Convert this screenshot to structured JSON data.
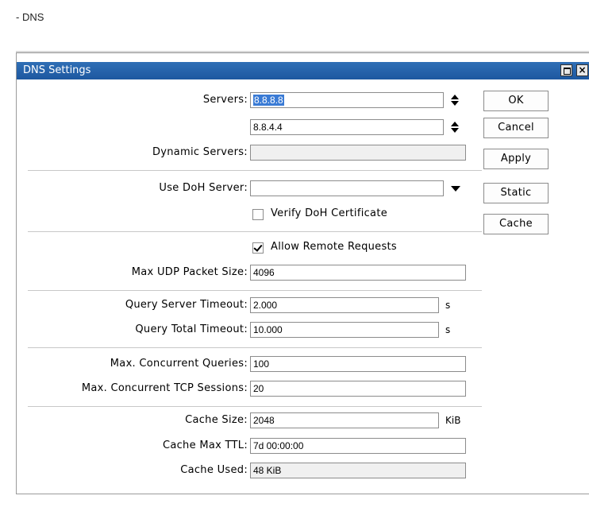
{
  "page": {
    "heading": "- DNS"
  },
  "window": {
    "title": "DNS Settings",
    "close_glyph": "×"
  },
  "form": {
    "servers_label": "Servers:",
    "server_1": "8.8.8.8",
    "server_2": "8.8.4.4",
    "dynamic_servers_label": "Dynamic Servers:",
    "dynamic_servers_value": "",
    "use_doh_label": "Use DoH Server:",
    "use_doh_value": "",
    "verify_doh_label": "Verify DoH Certificate",
    "verify_doh_checked": false,
    "allow_remote_label": "Allow Remote Requests",
    "allow_remote_checked": true,
    "max_udp_label": "Max UDP Packet Size:",
    "max_udp_value": "4096",
    "query_server_timeout_label": "Query Server Timeout:",
    "query_server_timeout_value": "2.000",
    "query_total_timeout_label": "Query Total Timeout:",
    "query_total_timeout_value": "10.000",
    "seconds_unit": "s",
    "max_concurrent_queries_label": "Max. Concurrent Queries:",
    "max_concurrent_queries_value": "100",
    "max_concurrent_tcp_label": "Max. Concurrent TCP Sessions:",
    "max_concurrent_tcp_value": "20",
    "cache_size_label": "Cache Size:",
    "cache_size_value": "2048",
    "cache_size_unit": "KiB",
    "cache_max_ttl_label": "Cache Max TTL:",
    "cache_max_ttl_value": "7d 00:00:00",
    "cache_used_label": "Cache Used:",
    "cache_used_value": "48 KiB"
  },
  "buttons": {
    "ok": "OK",
    "cancel": "Cancel",
    "apply": "Apply",
    "static": "Static",
    "cache": "Cache"
  },
  "colors": {
    "titlebar": "#1d57a0",
    "selection": "#3a7bd5"
  }
}
